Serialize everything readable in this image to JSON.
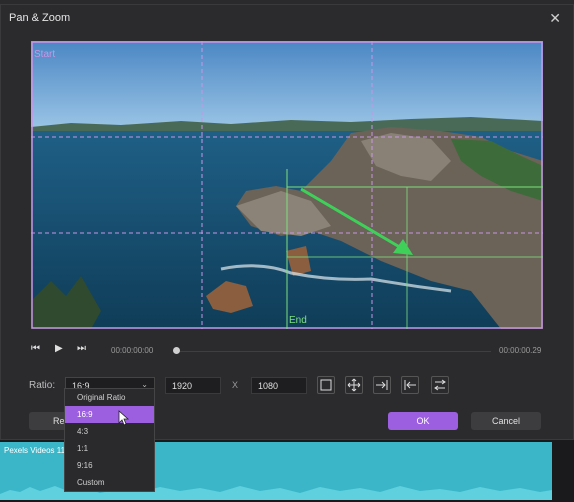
{
  "dialog": {
    "title": "Pan & Zoom",
    "close_icon": "close-icon"
  },
  "preview": {
    "start_label": "Start",
    "end_label": "End"
  },
  "transport": {
    "time_start": "00:00:00:00",
    "time_end": "00:00:00.29",
    "position": 0
  },
  "ratio": {
    "label": "Ratio:",
    "selected": "16:9",
    "width": "1920",
    "x_label": "X",
    "height": "1080",
    "options": [
      "Original Ratio",
      "16:9",
      "4:3",
      "1:1",
      "9:16",
      "Custom"
    ],
    "selected_index": 1
  },
  "buttons": {
    "reset": "Re",
    "ok": "OK",
    "cancel": "Cancel"
  },
  "timeline": {
    "clip_label": "Pexels Videos 11"
  },
  "colors": {
    "accent": "#9b5fe0",
    "start_frame": "#c896e6",
    "end_frame": "#7de07d",
    "clip": "#3bb6c8"
  }
}
